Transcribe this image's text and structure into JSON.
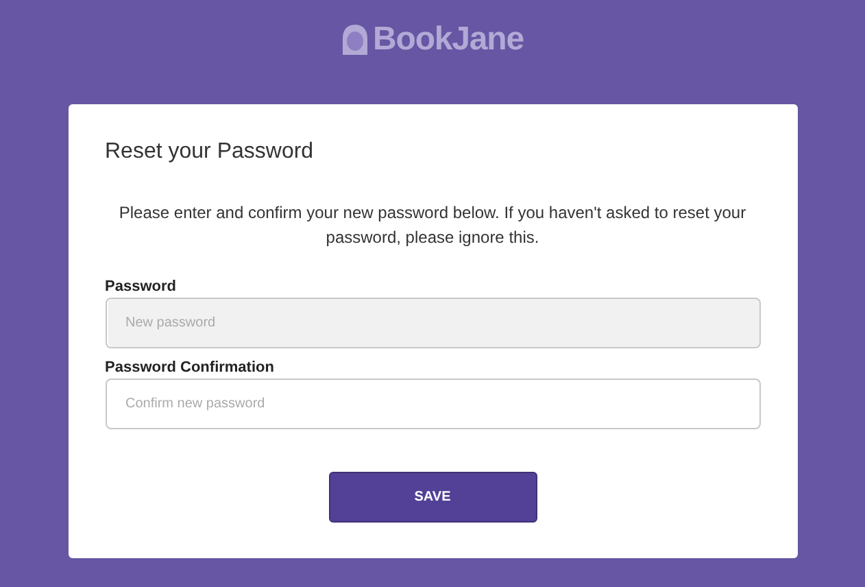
{
  "logo": {
    "text": "BookJane"
  },
  "card": {
    "title": "Reset your Password",
    "message": "Please enter and confirm your new password below. If you haven't asked to reset your password, please ignore this.",
    "fields": [
      {
        "label": "Password",
        "placeholder": "New password",
        "focused": true
      },
      {
        "label": "Password Confirmation",
        "placeholder": "Confirm new password",
        "focused": false
      }
    ],
    "button": "SAVE"
  }
}
